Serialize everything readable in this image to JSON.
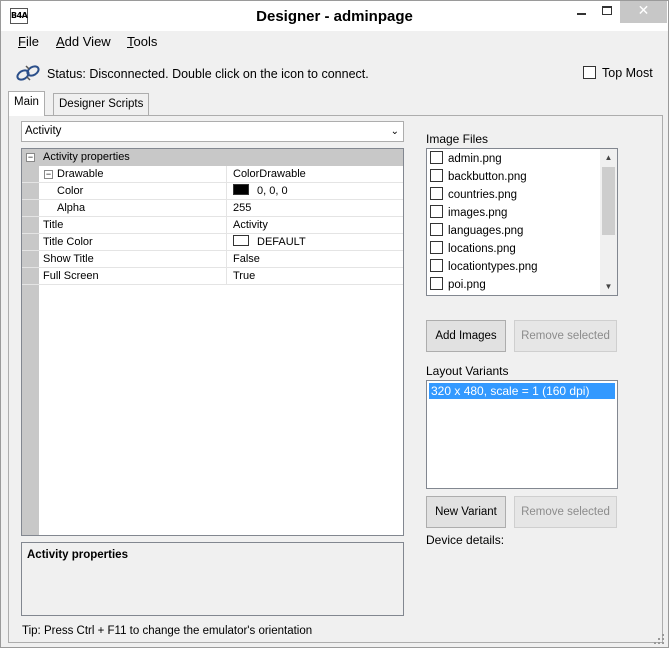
{
  "window": {
    "title": "Designer - adminpage",
    "logo_text": "B4A",
    "close_glyph": "✕"
  },
  "menu": {
    "file": {
      "mnemonic": "F",
      "rest": "ile"
    },
    "add_view": {
      "mnemonic": "A",
      "rest": "dd View"
    },
    "tools": {
      "mnemonic": "T",
      "rest": "ools"
    }
  },
  "status": {
    "text": "Status: Disconnected. Double click on the icon to connect.",
    "icon": "disconnected-link-icon",
    "top_most_label": "Top Most",
    "top_most_checked": false
  },
  "tabs": [
    {
      "label": "Main",
      "active": true
    },
    {
      "label": "Designer Scripts",
      "active": false
    }
  ],
  "object_selector": {
    "value": "Activity"
  },
  "properties": {
    "category": "Activity properties",
    "rows": [
      {
        "name": "Drawable",
        "value": "ColorDrawable",
        "expander": "−"
      },
      {
        "name": "Color",
        "value": "0, 0, 0",
        "swatch": "#000000"
      },
      {
        "name": "Alpha",
        "value": "255"
      },
      {
        "name": "Title",
        "value": "Activity"
      },
      {
        "name": "Title Color",
        "value": "DEFAULT",
        "swatch": "#ffffff"
      },
      {
        "name": "Show Title",
        "value": "False"
      },
      {
        "name": "Full Screen",
        "value": "True"
      }
    ],
    "description_title": "Activity properties"
  },
  "tip": "Tip: Press Ctrl + F11 to change the emulator's orientation",
  "image_files": {
    "label": "Image Files",
    "items": [
      "admin.png",
      "backbutton.png",
      "countries.png",
      "images.png",
      "languages.png",
      "locations.png",
      "locationtypes.png",
      "poi.png"
    ],
    "add_button": "Add Images",
    "remove_button": "Remove selected"
  },
  "layout_variants": {
    "label": "Layout Variants",
    "items": [
      "320 x 480, scale = 1 (160 dpi)"
    ],
    "new_button": "New Variant",
    "remove_button": "Remove selected"
  },
  "device_details_label": "Device details:",
  "colors": {
    "selection": "#3399ff",
    "category_row": "#c8c8c8",
    "close_button": "#c7c7c7"
  }
}
